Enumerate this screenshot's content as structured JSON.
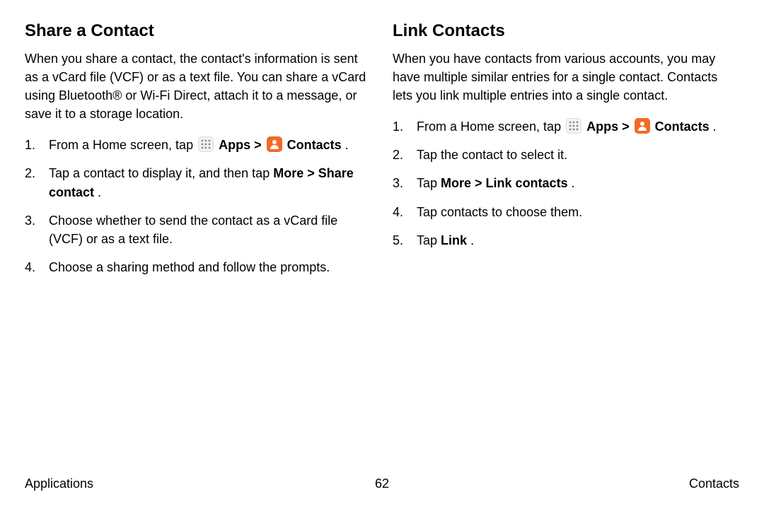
{
  "left": {
    "heading": "Share a Contact",
    "intro": "When you share a contact, the contact's information is sent as a vCard file (VCF) or as a text file. You can share a vCard using Bluetooth® or Wi-Fi Direct, attach it to a message, or save it to a storage location.",
    "step1_pre": "From a Home screen, tap ",
    "apps_label": "Apps",
    "chevron": " > ",
    "contacts_label": "Contacts",
    "period": " .",
    "step2_pre": "Tap a contact to display it, and then tap ",
    "step2_more": "More",
    "step2_share": "Share contact",
    "step2_end": ".",
    "step3": "Choose whether to send the contact as a vCard file (VCF) or as a text file.",
    "step4": "Choose a sharing method and follow the prompts."
  },
  "right": {
    "heading": "Link Contacts",
    "intro": "When you have contacts from various accounts, you may have multiple similar entries for a single contact. Contacts lets you link multiple entries into a single contact.",
    "step1_pre": "From a Home screen, tap ",
    "apps_label": "Apps",
    "chevron": " > ",
    "contacts_label": "Contacts",
    "period": " .",
    "step2": "Tap the contact to select it.",
    "step3_pre": "Tap ",
    "step3_bold": "More > Link contacts",
    "step3_end": ".",
    "step4": "Tap contacts to choose them.",
    "step5_pre": "Tap ",
    "step5_bold": "Link",
    "step5_end": "."
  },
  "footer": {
    "left": "Applications",
    "center": "62",
    "right": "Contacts"
  },
  "nums": {
    "n1": "1.",
    "n2": "2.",
    "n3": "3.",
    "n4": "4.",
    "n5": "5."
  }
}
